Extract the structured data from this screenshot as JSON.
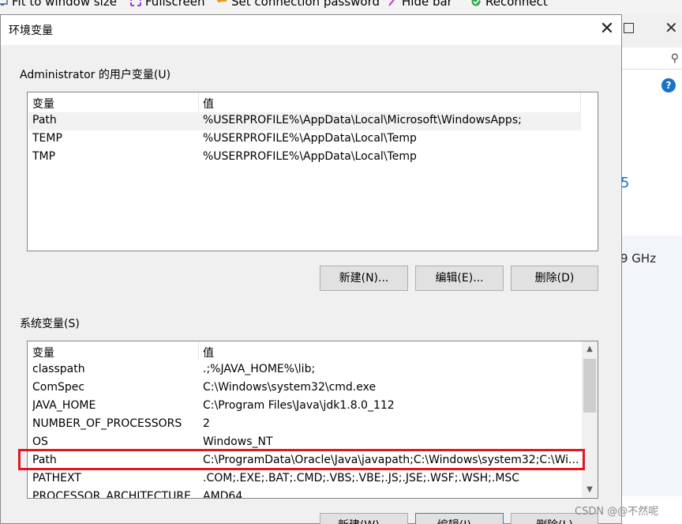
{
  "toolbar": {
    "items": [
      {
        "label": "Fit to window size",
        "icon": "monitor-icon"
      },
      {
        "label": "Fullscreen",
        "icon": "fullscreen-icon"
      },
      {
        "label": "Set connection password",
        "icon": "key-icon"
      },
      {
        "label": "Hide bar",
        "icon": "pin-icon"
      },
      {
        "label": "Reconnect",
        "icon": "reconnect-icon"
      }
    ]
  },
  "background_window": {
    "partial_value": "5",
    "partial_ghz": "9 GHz",
    "help": "?"
  },
  "dialog": {
    "title": "环境变量",
    "user_vars": {
      "group_label": "Administrator 的用户变量(U)",
      "columns": [
        "变量",
        "值"
      ],
      "rows": [
        {
          "name": "Path",
          "value": "%USERPROFILE%\\AppData\\Local\\Microsoft\\WindowsApps;",
          "selected": true
        },
        {
          "name": "TEMP",
          "value": "%USERPROFILE%\\AppData\\Local\\Temp"
        },
        {
          "name": "TMP",
          "value": "%USERPROFILE%\\AppData\\Local\\Temp"
        }
      ],
      "buttons": {
        "new": "新建(N)...",
        "edit": "编辑(E)...",
        "delete": "删除(D)"
      }
    },
    "system_vars": {
      "group_label": "系统变量(S)",
      "columns": [
        "变量",
        "值"
      ],
      "rows": [
        {
          "name": "classpath",
          "value": ".;%JAVA_HOME%\\lib;"
        },
        {
          "name": "ComSpec",
          "value": "C:\\Windows\\system32\\cmd.exe"
        },
        {
          "name": "JAVA_HOME",
          "value": "C:\\Program Files\\Java\\jdk1.8.0_112"
        },
        {
          "name": "NUMBER_OF_PROCESSORS",
          "value": "2"
        },
        {
          "name": "OS",
          "value": "Windows_NT"
        },
        {
          "name": "Path",
          "value": "C:\\ProgramData\\Oracle\\Java\\javapath;C:\\Windows\\system32;C:\\Wi...",
          "highlighted": true
        },
        {
          "name": "PATHEXT",
          "value": ".COM;.EXE;.BAT;.CMD;.VBS;.VBE;.JS;.JSE;.WSF;.WSH;.MSC"
        },
        {
          "name": "PROCESSOR_ARCHITECTURE",
          "value": "AMD64"
        }
      ],
      "buttons": {
        "new": "新建(W)...",
        "edit": "编辑(I)...",
        "delete": "删除(L)"
      }
    }
  },
  "watermark": "CSDN @@不然呢",
  "colors": {
    "highlight": "#e0191e",
    "selection": "#f2f2f2",
    "button": "#e1e1e1"
  }
}
